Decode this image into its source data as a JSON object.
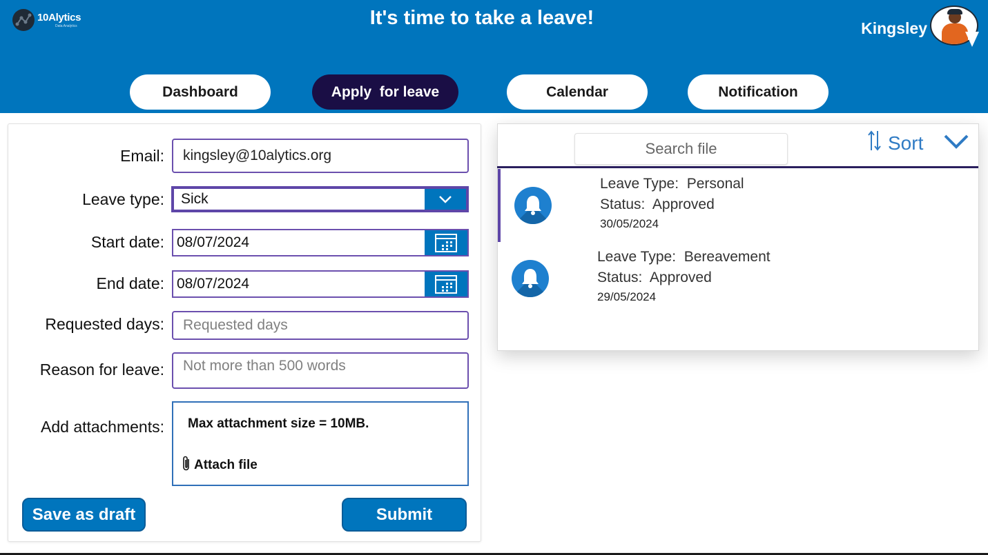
{
  "header": {
    "logo_name": "10Alytics",
    "logo_tagline": "Data Analytics",
    "title": "It's time to take a leave!",
    "user_name": "Kingsley",
    "background_color": "#0075bd"
  },
  "nav": {
    "tabs": [
      {
        "label": "Dashboard",
        "active": false
      },
      {
        "label": "Apply  for leave",
        "active": true
      },
      {
        "label": "Calendar",
        "active": false
      },
      {
        "label": "Notification",
        "active": false
      }
    ]
  },
  "form": {
    "email_label": "Email:",
    "email_value": "kingsley@10alytics.org",
    "leave_type_label": "Leave type:",
    "leave_type_value": "Sick",
    "start_date_label": "Start date:",
    "start_date_value": "08/07/2024",
    "end_date_label": "End date:",
    "end_date_value": "08/07/2024",
    "requested_days_label": "Requested days:",
    "requested_days_placeholder": "Requested days",
    "reason_label": "Reason for leave:",
    "reason_placeholder": "Not more than 500 words",
    "attachments_label": "Add attachments:",
    "attachment_note": "Max attachment size = 10MB.",
    "attach_file_label": "Attach file",
    "save_draft_label": "Save as draft",
    "submit_label": "Submit"
  },
  "panel": {
    "search_placeholder": "Search file",
    "sort_label": "Sort",
    "items": [
      {
        "type_label": "Leave Type:",
        "type_value": "Personal",
        "status_label": "Status:",
        "status_value": "Approved",
        "date": "30/05/2024",
        "selected": true
      },
      {
        "type_label": "Leave Type:",
        "type_value": "Bereavement",
        "status_label": "Status:",
        "status_value": "Approved",
        "date": "29/05/2024",
        "selected": false
      }
    ]
  },
  "colors": {
    "primary": "#0075bd",
    "active_tab": "#1a0e45",
    "field_border": "#6b4fae",
    "sort_blue": "#2f7bc4"
  }
}
